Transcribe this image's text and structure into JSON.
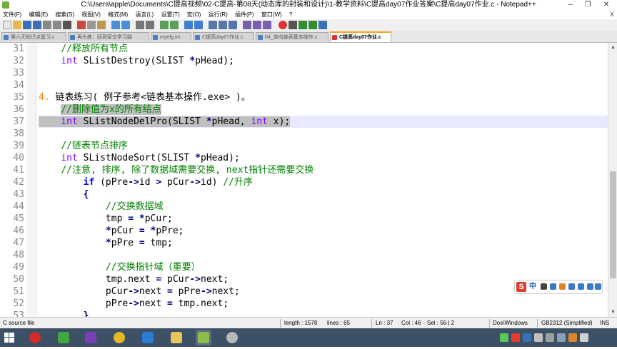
{
  "window": {
    "title": "C:\\Users\\apple\\Documents\\C提高视频\\02-C提高-第08天(动态库的封装和设计)\\1-教学资料\\C提高day07作业答案\\C提高day07作业.c - Notepad++",
    "minimize_glyph": "–",
    "maximize_glyph": "❐",
    "close_glyph": "✕"
  },
  "menu": {
    "items": [
      "文件(F)",
      "编辑(E)",
      "搜索(S)",
      "视图(V)",
      "格式(M)",
      "语言(L)",
      "设置(T)",
      "宏(O)",
      "运行(R)",
      "插件(P)",
      "窗口(W)",
      "?"
    ],
    "close_glyph": "X"
  },
  "tabs": [
    {
      "label": "第六天知识点复习.c",
      "active": false
    },
    {
      "label": "再头练：回到家交学习路",
      "active": false
    },
    {
      "label": "myefg.ini",
      "active": false
    },
    {
      "label": "C提高day07作业.c",
      "active": false
    },
    {
      "label": "04_单向链表基本操作.c",
      "active": false
    },
    {
      "label": "C提高day07作业.c",
      "active": true
    }
  ],
  "editor": {
    "lines": [
      {
        "n": "31",
        "segs": [
          {
            "t": "    "
          },
          {
            "t": "//释放所有节点",
            "c": "cm"
          }
        ]
      },
      {
        "n": "32",
        "segs": [
          {
            "t": "    "
          },
          {
            "t": "int",
            "c": "kw"
          },
          {
            "t": " SListDestroy(SLIST "
          },
          {
            "t": "*",
            "c": "op"
          },
          {
            "t": "pHead);"
          }
        ]
      },
      {
        "n": "33",
        "segs": []
      },
      {
        "n": "34",
        "segs": []
      },
      {
        "n": "35",
        "segs": [
          {
            "t": "4.",
            "c": "num"
          },
          {
            "t": " 链表练习( 例子参考<链表基本操作.exe> )。"
          }
        ]
      },
      {
        "n": "36",
        "segs": [
          {
            "t": "    "
          },
          {
            "t": "//删除值为x的所有结点",
            "c": "cm",
            "s": true
          }
        ]
      },
      {
        "n": "37",
        "hl": true,
        "segs": [
          {
            "t": "    ",
            "s": true
          },
          {
            "t": "int",
            "c": "kw",
            "s": true
          },
          {
            "t": " SListNodeDelPro(SLIST ",
            "s": true
          },
          {
            "t": "*",
            "c": "op",
            "s": true
          },
          {
            "t": "pHead, ",
            "s": true
          },
          {
            "t": "int",
            "c": "kw",
            "s": true
          },
          {
            "t": " x);",
            "s": true
          }
        ]
      },
      {
        "n": "38",
        "segs": []
      },
      {
        "n": "39",
        "segs": [
          {
            "t": "    "
          },
          {
            "t": "//链表节点排序",
            "c": "cm"
          }
        ]
      },
      {
        "n": "40",
        "segs": [
          {
            "t": "    "
          },
          {
            "t": "int",
            "c": "kw"
          },
          {
            "t": " SListNodeSort(SLIST "
          },
          {
            "t": "*",
            "c": "op"
          },
          {
            "t": "pHead);"
          }
        ]
      },
      {
        "n": "41",
        "segs": [
          {
            "t": "    "
          },
          {
            "t": "//注意, 排序, 除了数据域需要交换, next指针还需要交换",
            "c": "cm"
          }
        ]
      },
      {
        "n": "42",
        "segs": [
          {
            "t": "        "
          },
          {
            "t": "if",
            "c": "kwb"
          },
          {
            "t": " (pPre"
          },
          {
            "t": "->",
            "c": "op"
          },
          {
            "t": "id "
          },
          {
            "t": ">",
            "c": "op"
          },
          {
            "t": " pCur"
          },
          {
            "t": "->",
            "c": "op"
          },
          {
            "t": "id) "
          },
          {
            "t": "//升序",
            "c": "cm"
          }
        ]
      },
      {
        "n": "43",
        "segs": [
          {
            "t": "        "
          },
          {
            "t": "{",
            "c": "op"
          }
        ]
      },
      {
        "n": "44",
        "segs": [
          {
            "t": "            "
          },
          {
            "t": "//交换数据域",
            "c": "cm"
          }
        ]
      },
      {
        "n": "45",
        "segs": [
          {
            "t": "            tmp "
          },
          {
            "t": "=",
            "c": "op"
          },
          {
            "t": " "
          },
          {
            "t": "*",
            "c": "op"
          },
          {
            "t": "pCur;"
          }
        ]
      },
      {
        "n": "46",
        "segs": [
          {
            "t": "            "
          },
          {
            "t": "*",
            "c": "op"
          },
          {
            "t": "pCur "
          },
          {
            "t": "=",
            "c": "op"
          },
          {
            "t": " "
          },
          {
            "t": "*",
            "c": "op"
          },
          {
            "t": "pPre;"
          }
        ]
      },
      {
        "n": "47",
        "segs": [
          {
            "t": "            "
          },
          {
            "t": "*",
            "c": "op"
          },
          {
            "t": "pPre "
          },
          {
            "t": "=",
            "c": "op"
          },
          {
            "t": " tmp;"
          }
        ]
      },
      {
        "n": "48",
        "segs": []
      },
      {
        "n": "49",
        "segs": [
          {
            "t": "            "
          },
          {
            "t": "//交换指针域（重要）",
            "c": "cm"
          }
        ]
      },
      {
        "n": "50",
        "segs": [
          {
            "t": "            tmp.next "
          },
          {
            "t": "=",
            "c": "op"
          },
          {
            "t": " pCur"
          },
          {
            "t": "->",
            "c": "op"
          },
          {
            "t": "next;"
          }
        ]
      },
      {
        "n": "51",
        "segs": [
          {
            "t": "            pCur"
          },
          {
            "t": "->",
            "c": "op"
          },
          {
            "t": "next "
          },
          {
            "t": "=",
            "c": "op"
          },
          {
            "t": " pPre"
          },
          {
            "t": "->",
            "c": "op"
          },
          {
            "t": "next;"
          }
        ]
      },
      {
        "n": "52",
        "segs": [
          {
            "t": "            pPre"
          },
          {
            "t": "->",
            "c": "op"
          },
          {
            "t": "next "
          },
          {
            "t": "=",
            "c": "op"
          },
          {
            "t": " tmp.next;"
          }
        ]
      },
      {
        "n": "53",
        "segs": [
          {
            "t": "        "
          },
          {
            "t": "}",
            "c": "op"
          }
        ]
      }
    ]
  },
  "ime": {
    "logo": "S",
    "lang": "中"
  },
  "status": {
    "file_type": "C source file",
    "length": "length : 1578",
    "lines": "lines : 65",
    "ln": "Ln : 37",
    "col": "Col : 46",
    "sel": "Sel : 56 | 2",
    "eol": "Dos\\Windows",
    "encoding": "GB2312 (Simplified)",
    "mode": "INS"
  },
  "colors": {
    "comment": "#008000",
    "keyword": "#8000ff",
    "current_line": "#e8e8ff",
    "selection": "#c0c0c0",
    "taskbar": "#3c5066"
  }
}
